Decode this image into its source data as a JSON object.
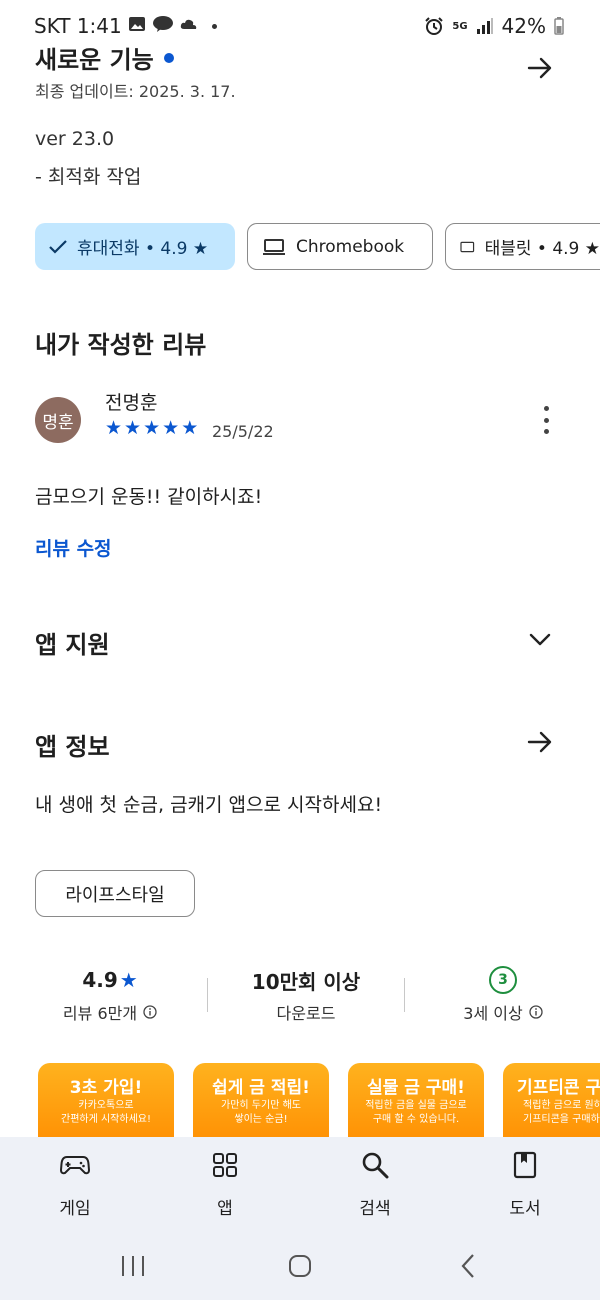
{
  "status_bar": {
    "time": "SKT 1:41",
    "network": "5G",
    "battery": "42%"
  },
  "whats_new": {
    "title": "새로운 기능",
    "updated": "최종 업데이트: 2025. 3. 17.",
    "version": "ver 23.0",
    "note": "- 최적화 작업"
  },
  "device_chips": [
    {
      "label": "휴대전화 • 4.9 ★",
      "selected": true
    },
    {
      "label": "Chromebook",
      "selected": false
    },
    {
      "label": "태블릿 • 4.9 ★",
      "selected": false
    }
  ],
  "my_review": {
    "section_title": "내가 작성한 리뷰",
    "avatar_text": "명훈",
    "reviewer": "전명훈",
    "rating": 5,
    "date": "25/5/22",
    "text": "금모으기 운동!! 같이하시죠!",
    "edit_label": "리뷰 수정"
  },
  "app_support": {
    "title": "앱 지원"
  },
  "app_info": {
    "title": "앱 정보",
    "description": "내 생애 첫 순금, 금캐기 앱으로 시작하세요!",
    "category": "라이프스타일"
  },
  "stats": {
    "rating_value": "4.9",
    "rating_label": "리뷰 6만개",
    "downloads_value": "10만회 이상",
    "downloads_label": "다운로드",
    "age_badge": "3",
    "age_label": "3세 이상"
  },
  "screenshots": [
    {
      "title": "3초 가입!",
      "sub1": "카카오톡으로",
      "sub2": "간편하게 시작하세요!"
    },
    {
      "title": "쉽게 금 적립!",
      "sub1": "가만히 두기만 해도",
      "sub2": "쌓이는 순금!"
    },
    {
      "title": "실물 금 구매!",
      "sub1": "적립한 금을 실물 금으로",
      "sub2": "구매 할 수 있습니다."
    },
    {
      "title": "기프티콘 구",
      "sub1": "적립한 금으로 원하",
      "sub2": "기프티콘을 구매하"
    }
  ],
  "bottom_nav": [
    {
      "label": "게임",
      "icon": "gamepad-icon"
    },
    {
      "label": "앱",
      "icon": "apps-grid-icon"
    },
    {
      "label": "검색",
      "icon": "search-icon"
    },
    {
      "label": "도서",
      "icon": "book-icon"
    }
  ],
  "colors": {
    "accent": "#0b57d0",
    "chip_selected": "#c2e7ff",
    "star": "#0b57d0",
    "age_green": "#1e8e3e",
    "nav_bg": "#eef1f7"
  }
}
